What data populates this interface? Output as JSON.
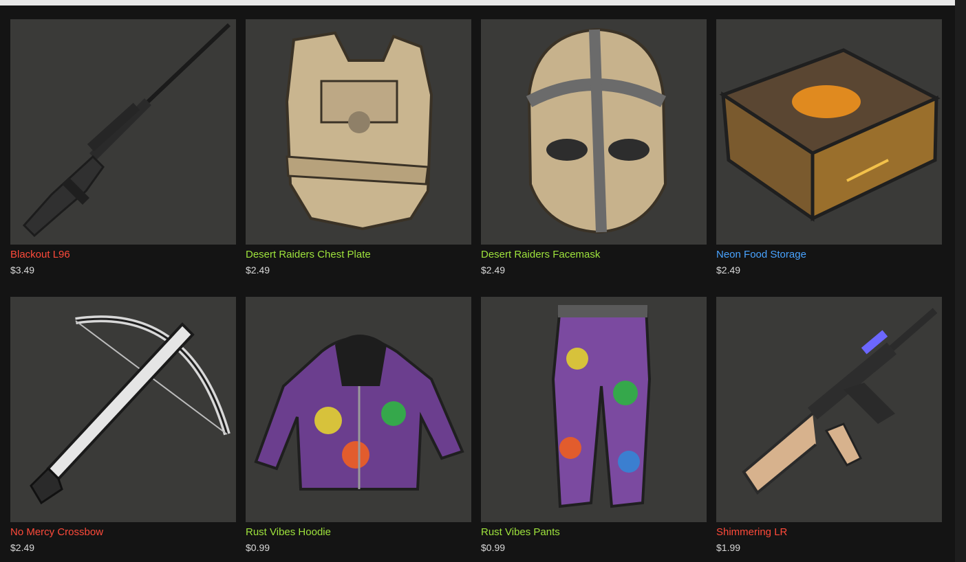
{
  "colors": {
    "page_background": "#141414",
    "tile_background": "#3a3a38",
    "price_text": "#d9d9d9",
    "rarity_red": "#ff4a3a",
    "rarity_green": "#9ee33c",
    "rarity_blue": "#49a3ff"
  },
  "items": [
    {
      "name": "Blackout L96",
      "price": "$3.49",
      "name_color": "#ff4a3a",
      "icon": "sniper-rifle-icon"
    },
    {
      "name": "Desert Raiders Chest Plate",
      "price": "$2.49",
      "name_color": "#9ee33c",
      "icon": "chest-plate-icon"
    },
    {
      "name": "Desert Raiders Facemask",
      "price": "$2.49",
      "name_color": "#9ee33c",
      "icon": "facemask-icon"
    },
    {
      "name": "Neon Food Storage",
      "price": "$2.49",
      "name_color": "#49a3ff",
      "icon": "storage-box-icon"
    },
    {
      "name": "No Mercy Crossbow",
      "price": "$2.49",
      "name_color": "#ff4a3a",
      "icon": "crossbow-icon"
    },
    {
      "name": "Rust Vibes Hoodie",
      "price": "$0.99",
      "name_color": "#9ee33c",
      "icon": "hoodie-icon"
    },
    {
      "name": "Rust Vibes Pants",
      "price": "$0.99",
      "name_color": "#9ee33c",
      "icon": "pants-icon"
    },
    {
      "name": "Shimmering LR",
      "price": "$1.99",
      "name_color": "#ff4a3a",
      "icon": "assault-rifle-icon"
    }
  ]
}
